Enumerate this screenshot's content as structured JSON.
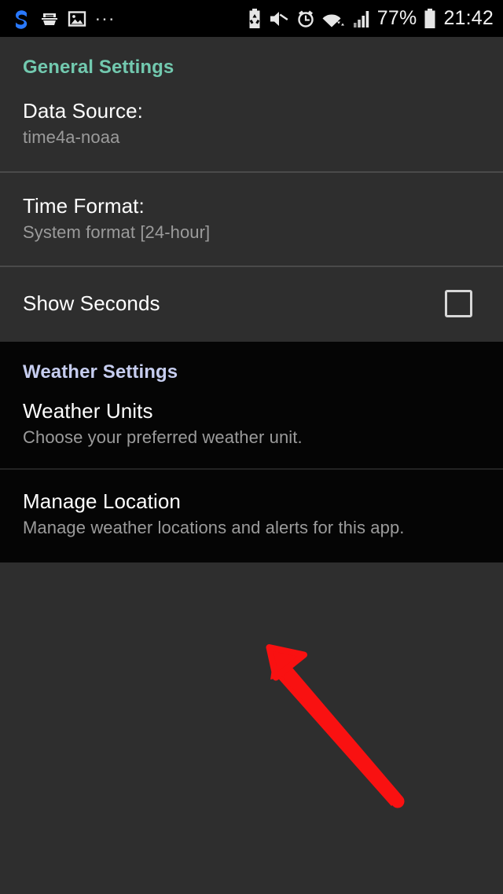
{
  "status_bar": {
    "left_icons": [
      {
        "name": "s-logo-icon",
        "label": "S"
      },
      {
        "name": "scanner-icon",
        "label": "scanner"
      },
      {
        "name": "image-icon",
        "label": "image"
      },
      {
        "name": "more-notifications-icon",
        "label": "..."
      }
    ],
    "right_icons": [
      {
        "name": "battery-saver-icon",
        "label": "battery-saver"
      },
      {
        "name": "mute-icon",
        "label": "mute"
      },
      {
        "name": "alarm-clock-icon",
        "label": "alarm"
      },
      {
        "name": "wifi-icon",
        "label": "wifi"
      },
      {
        "name": "signal-bars-icon",
        "label": "signal"
      }
    ],
    "battery_percent": "77%",
    "clock": "21:42"
  },
  "colors": {
    "general_header": "#72c9af",
    "weather_header": "#c6cdef",
    "accent_red": "#f91111",
    "dark_bg": "#2e2e2e",
    "black_bg": "#050505"
  },
  "sections": [
    {
      "id": "general",
      "header": "General Settings",
      "rows": [
        {
          "id": "data-source",
          "title": "Data Source:",
          "subtitle": "time4a-noaa"
        },
        {
          "id": "time-format",
          "title": "Time Format:",
          "subtitle": "System format [24-hour]"
        },
        {
          "id": "show-seconds",
          "title": "Show Seconds",
          "subtitle": "",
          "checkbox_checked": false
        }
      ]
    },
    {
      "id": "weather",
      "header": "Weather Settings",
      "rows": [
        {
          "id": "weather-units",
          "title": "Weather Units",
          "subtitle": "Choose your preferred weather unit."
        },
        {
          "id": "manage-location",
          "title": "Manage Location",
          "subtitle": "Manage weather locations and alerts for this app."
        }
      ]
    }
  ],
  "annotation": {
    "name": "red-arrow",
    "points_to": "manage-location-row",
    "color": "#f91111"
  }
}
